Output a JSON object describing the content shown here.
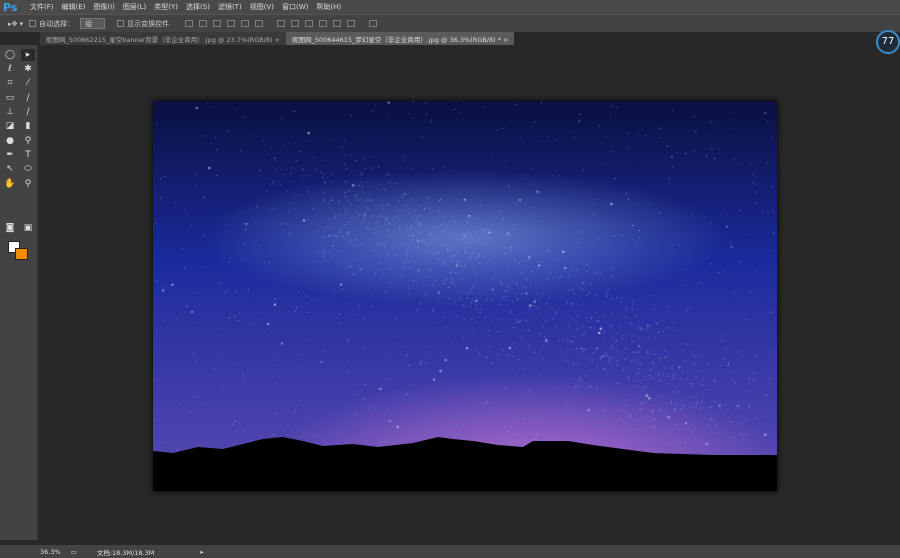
{
  "app": {
    "logo": "Ps"
  },
  "menu": [
    "文件(F)",
    "编辑(E)",
    "图像(I)",
    "图层(L)",
    "类型(Y)",
    "选择(S)",
    "滤镜(T)",
    "视图(V)",
    "窗口(W)",
    "帮助(H)"
  ],
  "options": {
    "auto_select_label": "自动选择：",
    "auto_select_value": "组",
    "show_transform_label": "显示变换控件",
    "auto_select_checked": false,
    "show_transform_checked": false
  },
  "tabs": [
    {
      "label": "昵图网_500862215_星空banner背景（非企业商用）.jpg @ 23.7%(RGB/8)",
      "close": "×",
      "active": false
    },
    {
      "label": "昵图网_500644615_梦幻星空（非企业商用）.jpg @ 36.3%(RGB/8) *",
      "close": "×",
      "active": true
    }
  ],
  "colors": {
    "foreground": "#ffffff",
    "background": "#f08c00"
  },
  "status": {
    "zoom": "36.3%",
    "doc": "文档:18.3M/18.3M",
    "arrow": "▸"
  },
  "badge": "77"
}
